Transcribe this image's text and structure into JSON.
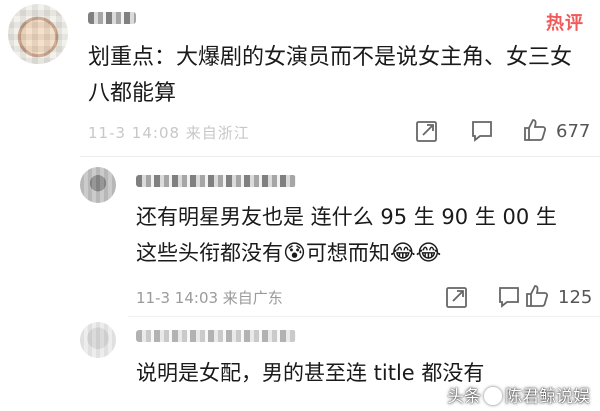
{
  "badge": {
    "label": "热评",
    "color": "#f05a5a"
  },
  "main_comment": {
    "text": "划重点：大爆剧的女演员而不是说女主角、女三女八都能算",
    "meta": "11-3 14:08 来自浙江",
    "actions": {
      "share_icon": "share-icon",
      "comment_icon": "comment-icon",
      "like_icon": "thumbs-up-icon"
    },
    "like_count": "677"
  },
  "reply1": {
    "text_a": "还有明星男友也是 连什么 95 生 90 生 00 生 这些头衔都没有",
    "emoji_a": "😰",
    "text_b": "可想而知",
    "emoji_b": "😂",
    "emoji_c": "😂",
    "meta": "11-3 14:03 来自广东",
    "like_count": "125"
  },
  "reply2": {
    "text": "说明是女配，男的甚至连 title 都没有"
  },
  "watermark": {
    "text_prefix": "头条",
    "text_suffix": "陈君鲸说娱"
  }
}
